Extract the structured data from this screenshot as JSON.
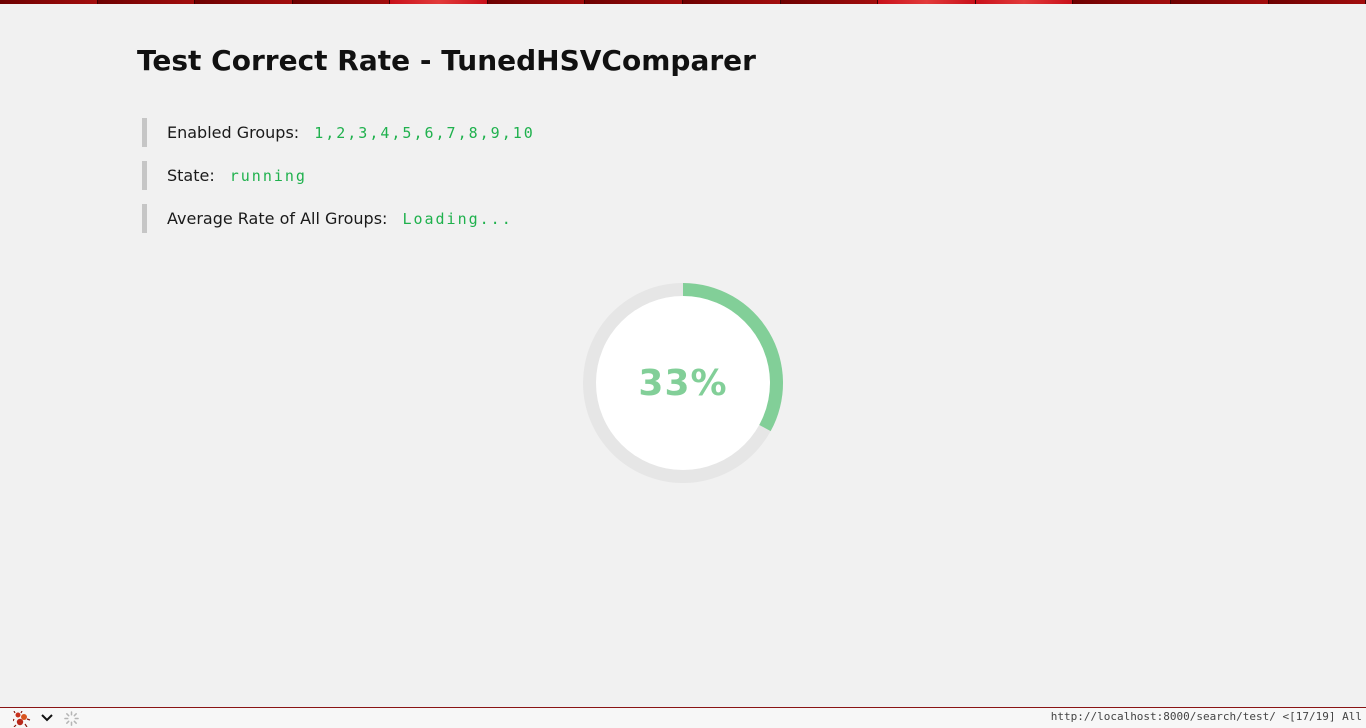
{
  "page": {
    "title": "Test Correct Rate - TunedHSVComparer"
  },
  "info": {
    "groups_label": "Enabled Groups:",
    "groups_value": "1,2,3,4,5,6,7,8,9,10",
    "state_label": "State:",
    "state_value": "running",
    "avg_label": "Average Rate of All Groups:",
    "avg_value": "Loading..."
  },
  "progress": {
    "percent": 33,
    "label": "33%",
    "track_color": "#e6e6e6",
    "fill_color": "#82cf98",
    "value_color": "#1fb14d"
  },
  "statusbar": {
    "url": "http://localhost:8000/search/test/",
    "position": "<[17/19]",
    "scroll": "All",
    "app_icon": "ant-icon",
    "menu_icon": "chevron-down-icon",
    "loading_icon": "spinner-icon"
  },
  "tabstrip": {
    "color": "#8b0000"
  }
}
